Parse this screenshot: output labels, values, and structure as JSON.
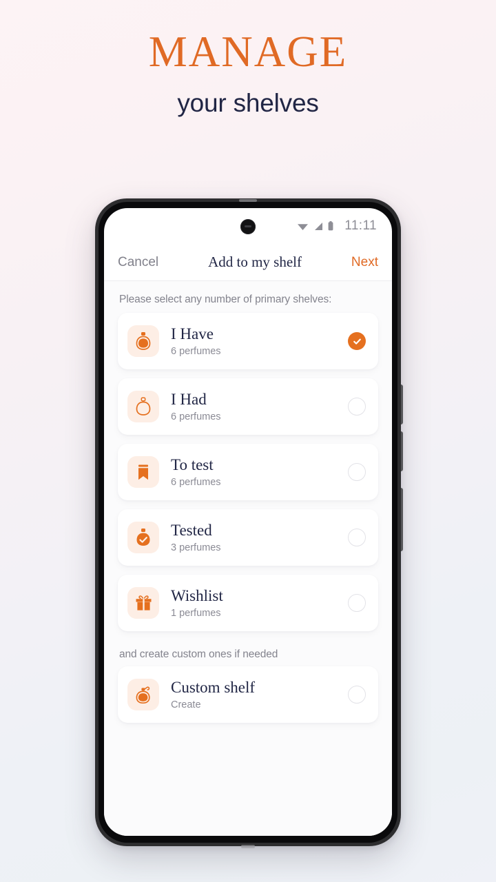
{
  "promo": {
    "title": "MANAGE",
    "subtitle": "your shelves",
    "title_color": "#e06a25",
    "subtitle_color": "#212645"
  },
  "phone": {
    "status_bar": {
      "time": "11:11",
      "icons": [
        "wifi-icon",
        "signal-icon",
        "battery-icon"
      ],
      "text_color": "#8e8e96"
    },
    "navbar": {
      "cancel_label": "Cancel",
      "title": "Add to my shelf",
      "next_label": "Next",
      "accent_color": "#e06a25"
    },
    "content": {
      "primary_section_label": "Please select any number of primary shelves:",
      "custom_section_label": "and create custom ones if needed",
      "shelves": [
        {
          "title": "I Have",
          "subtitle": "6 perfumes",
          "icon": "perfume-bottle-filled-icon",
          "selected": true
        },
        {
          "title": "I Had",
          "subtitle": "6 perfumes",
          "icon": "perfume-bottle-outline-icon",
          "selected": false
        },
        {
          "title": "To test",
          "subtitle": "6 perfumes",
          "icon": "bookmark-icon",
          "selected": false
        },
        {
          "title": "Tested",
          "subtitle": "3 perfumes",
          "icon": "perfume-bottle-check-icon",
          "selected": false
        },
        {
          "title": "Wishlist",
          "subtitle": "1 perfumes",
          "icon": "gift-icon",
          "selected": false
        }
      ],
      "custom_shelves": [
        {
          "title": "Custom shelf",
          "subtitle": "Create",
          "icon": "atomizer-bottle-icon",
          "selected": false
        }
      ]
    }
  },
  "theme": {
    "accent": "#e5701f",
    "tile_bg": "#fdeee5",
    "card_bg": "#ffffff",
    "text_dark": "#212645",
    "text_muted": "#8b8b95"
  }
}
